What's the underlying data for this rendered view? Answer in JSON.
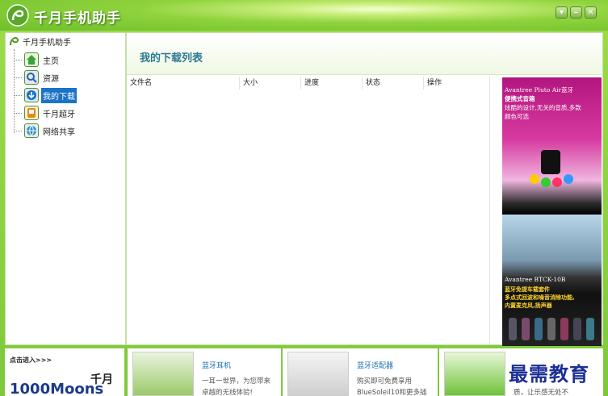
{
  "app": {
    "title": "千月手机助手"
  },
  "window_controls": {
    "menu": "▾",
    "minimize": "–",
    "close": "✕"
  },
  "tree": {
    "root_label": "千月手机助手",
    "items": [
      {
        "label": "主页",
        "icon": "home-icon",
        "color": "#3aa23a"
      },
      {
        "label": "资源",
        "icon": "resource-search-icon",
        "color": "#2b5fa8"
      },
      {
        "label": "我的下载",
        "icon": "download-icon",
        "color": "#1a73c8",
        "selected": true
      },
      {
        "label": "千月超牙",
        "icon": "bluetooth-icon",
        "color": "#e08a1a"
      },
      {
        "label": "网络共享",
        "icon": "network-share-icon",
        "color": "#3a8ec8"
      }
    ]
  },
  "main": {
    "title": "我的下载列表",
    "columns": [
      "文件名",
      "大小",
      "进度",
      "状态",
      "操作"
    ]
  },
  "ad": {
    "top_line1": "Avantree Pluto Air蓝牙",
    "top_line2": "便携式音箱",
    "top_line3": "炫酷的设计,无关的音质,多款",
    "top_line4": "颜色可选",
    "bottom_line1": "Avantree BTCK-10B",
    "bottom_line2": "蓝牙免提车载套件",
    "bottom_line3": "多点式回波和噪音消除功能,",
    "bottom_line4": "内置麦克风,扬声器"
  },
  "bottom": {
    "enter_label": "点击进入>>>",
    "brand_cn": "千月",
    "brand_en": "1000Moons",
    "promos": [
      {
        "title": "蓝牙耳机",
        "desc1": "一耳一世界，为您带来",
        "desc2": "卓越的无线体验!"
      },
      {
        "title": "蓝牙适配器",
        "desc1": "购买即可免费享用",
        "desc2": "BlueSoleil10和更多插"
      },
      {
        "title": "",
        "desc1": "",
        "desc2": "质，让乐感无处不"
      }
    ]
  },
  "watermark": "最需教育",
  "colors": {
    "accent_green": "#8fd33d",
    "selected_blue": "#1a73c8",
    "title_teal": "#2c7a92"
  }
}
